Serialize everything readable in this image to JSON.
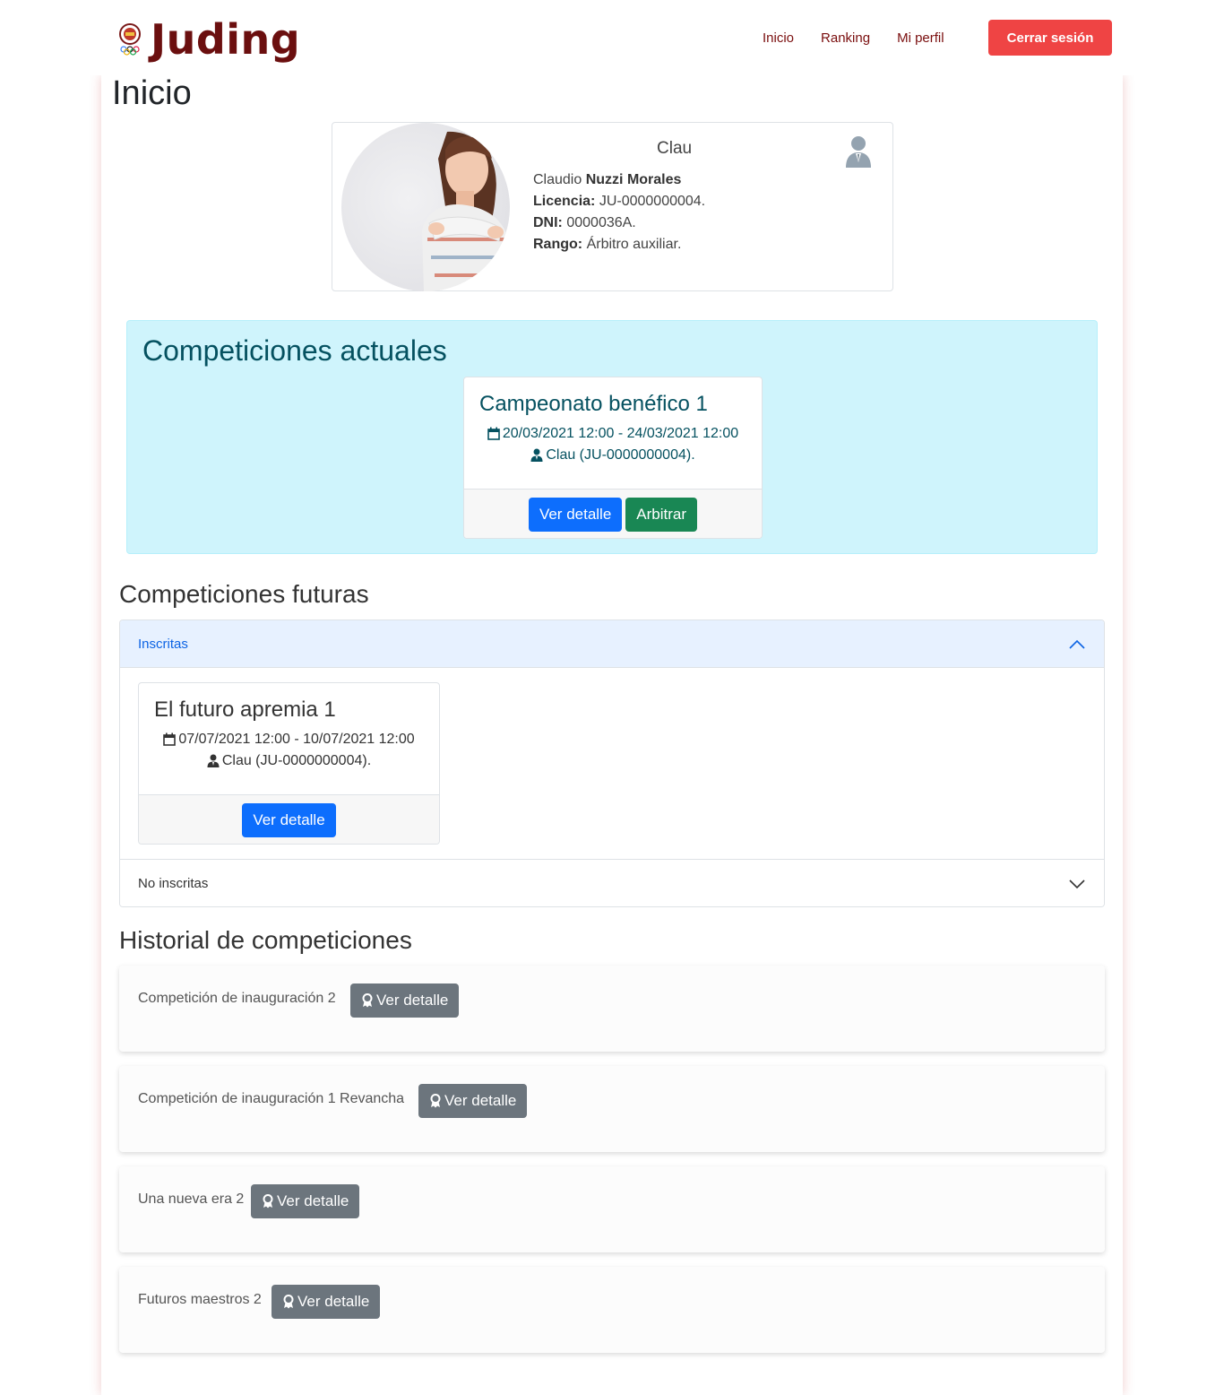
{
  "brand": {
    "name": "Juding"
  },
  "nav": {
    "items": [
      "Inicio",
      "Ranking",
      "Mi perfil"
    ],
    "logout": "Cerrar sesión"
  },
  "page": {
    "title": "Inicio"
  },
  "profile": {
    "nickname": "Clau",
    "first_name": "Claudio",
    "last_names": "Nuzzi Morales",
    "license_label": "Licencia:",
    "license": "JU-0000000004.",
    "dni_label": "DNI:",
    "dni": "0000036A.",
    "rank_label": "Rango:",
    "rank": "Árbitro auxiliar.",
    "role_icon": "referee-user-icon"
  },
  "current": {
    "title": "Competiciones actuales",
    "cards": [
      {
        "name": "Campeonato benéfico 1",
        "dates": "20/03/2021 12:00 - 24/03/2021 12:00",
        "referee": "Clau (JU-0000000004).",
        "detail_label": "Ver detalle",
        "judge_label": "Arbitrar"
      }
    ]
  },
  "future": {
    "title": "Competiciones futuras",
    "registered_label": "Inscritas",
    "unregistered_label": "No inscritas",
    "cards": [
      {
        "name": "El futuro apremia 1",
        "dates": "07/07/2021 12:00 - 10/07/2021 12:00",
        "referee": "Clau (JU-0000000004).",
        "detail_label": "Ver detalle"
      }
    ]
  },
  "history": {
    "title": "Historial de competiciones",
    "items": [
      {
        "name": "Competición de inauguración 2",
        "button": "Ver detalle"
      },
      {
        "name": "Competición de inauguración 1 Revancha",
        "button": "Ver detalle"
      },
      {
        "name": "Una nueva era 2",
        "button": "Ver detalle"
      },
      {
        "name": "Futuros maestros 2",
        "button": "Ver detalle"
      }
    ]
  },
  "colors": {
    "brand": "#6b0f0f",
    "logout": "#ef4444",
    "primary": "#0d6efd",
    "success": "#198754",
    "secondary": "#6c757d",
    "info_bg": "#cff4fc",
    "info_text": "#055160"
  }
}
